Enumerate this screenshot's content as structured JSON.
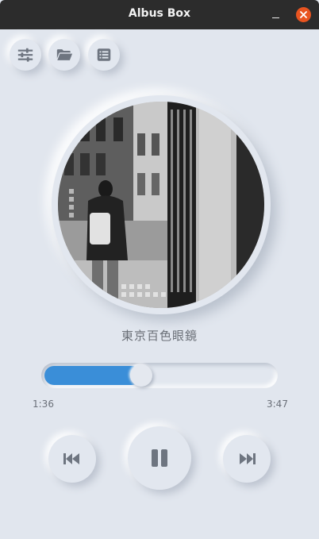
{
  "window": {
    "title": "Albus Box",
    "minimize_icon": "minimize-icon",
    "close_icon": "close-icon",
    "close_color": "#e95420"
  },
  "toolbar": {
    "equalizer_icon": "sliders-icon",
    "open_folder_icon": "folder-open-icon",
    "playlist_icon": "list-icon"
  },
  "now_playing": {
    "title": "東京百色眼鏡",
    "elapsed": "1:36",
    "duration": "3:47",
    "progress": 0.42
  },
  "controls": {
    "previous_icon": "skip-back-icon",
    "pause_icon": "pause-icon",
    "next_icon": "skip-forward-icon"
  },
  "colors": {
    "accent": "#3a8ed8",
    "background": "#e1e6ee",
    "titlebar": "#2c2c2c"
  }
}
